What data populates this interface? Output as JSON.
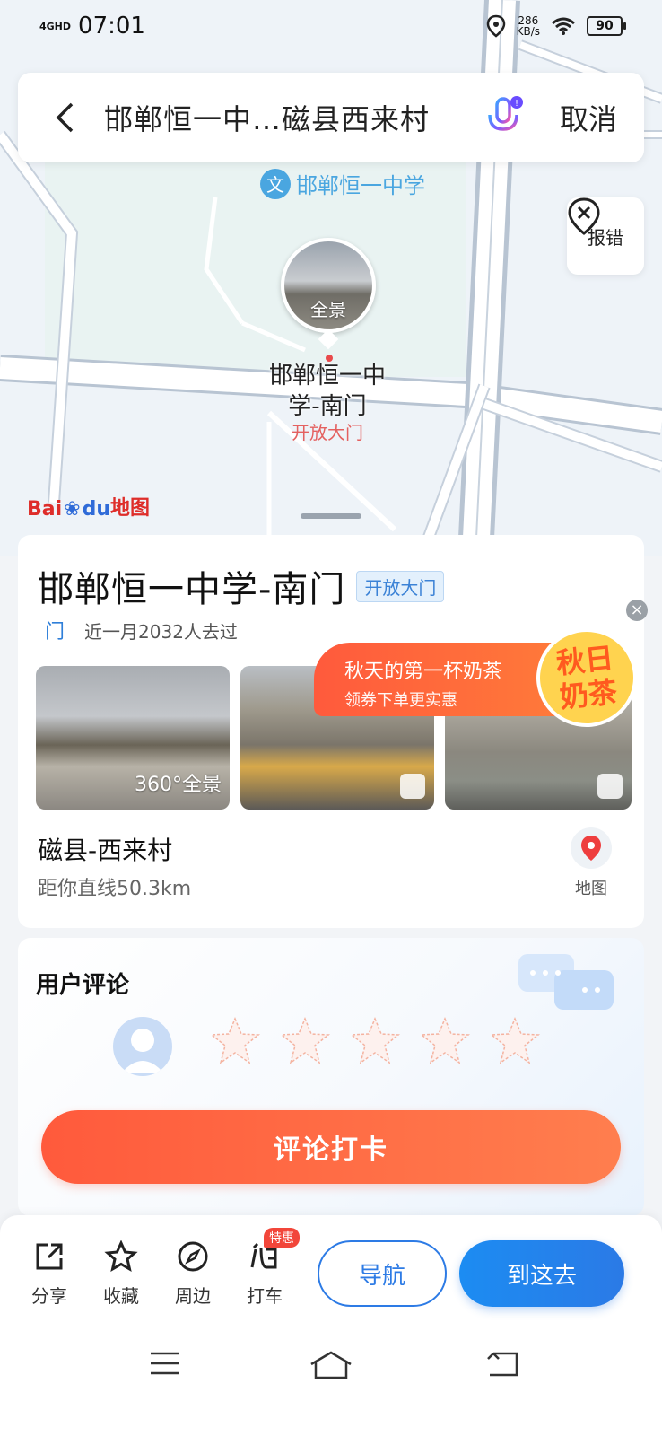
{
  "status_bar": {
    "network": "4GHD",
    "time": "07:01",
    "net_speed_value": "286",
    "net_speed_unit": "KB/s",
    "battery": "90"
  },
  "search": {
    "query": "邯郸恒一中…磁县西来村",
    "cancel_label": "取消"
  },
  "map": {
    "school_poi": "邯郸恒一中学",
    "pano_label": "全景",
    "pin_label": "邯郸恒一中学-南门",
    "pin_sublabel": "开放大门",
    "report_label": "报错",
    "logo_text_1": "Bai",
    "logo_text_2": "du",
    "logo_text_3": "地图"
  },
  "place": {
    "title": "邯郸恒一中学-南门",
    "tag": "开放大门",
    "door_icon_char": "门",
    "visits": "近一月2032人去过",
    "photo_pano_label": "360°全景",
    "destination": "磁县-西来村",
    "distance": "距你直线50.3km",
    "map_label": "地图"
  },
  "ad": {
    "title": "秋天的第一杯奶茶",
    "subtitle": "领券下单更实惠",
    "badge_line1": "秋日",
    "badge_line2": "奶茶"
  },
  "comments": {
    "title": "用户评论",
    "rating_max": 5,
    "rating_value": 0,
    "button_label": "评论打卡"
  },
  "bottom": {
    "actions": [
      {
        "label": "分享",
        "icon": "share-icon"
      },
      {
        "label": "收藏",
        "icon": "star-icon"
      },
      {
        "label": "周边",
        "icon": "compass-icon"
      },
      {
        "label": "打车",
        "icon": "taxi-icon",
        "tag": "特惠"
      }
    ],
    "nav_label": "导航",
    "go_label": "到这去"
  },
  "colors": {
    "accent_blue": "#2d7be5",
    "accent_orange": "#ff5a3c",
    "map_bg": "#eef3f8"
  }
}
